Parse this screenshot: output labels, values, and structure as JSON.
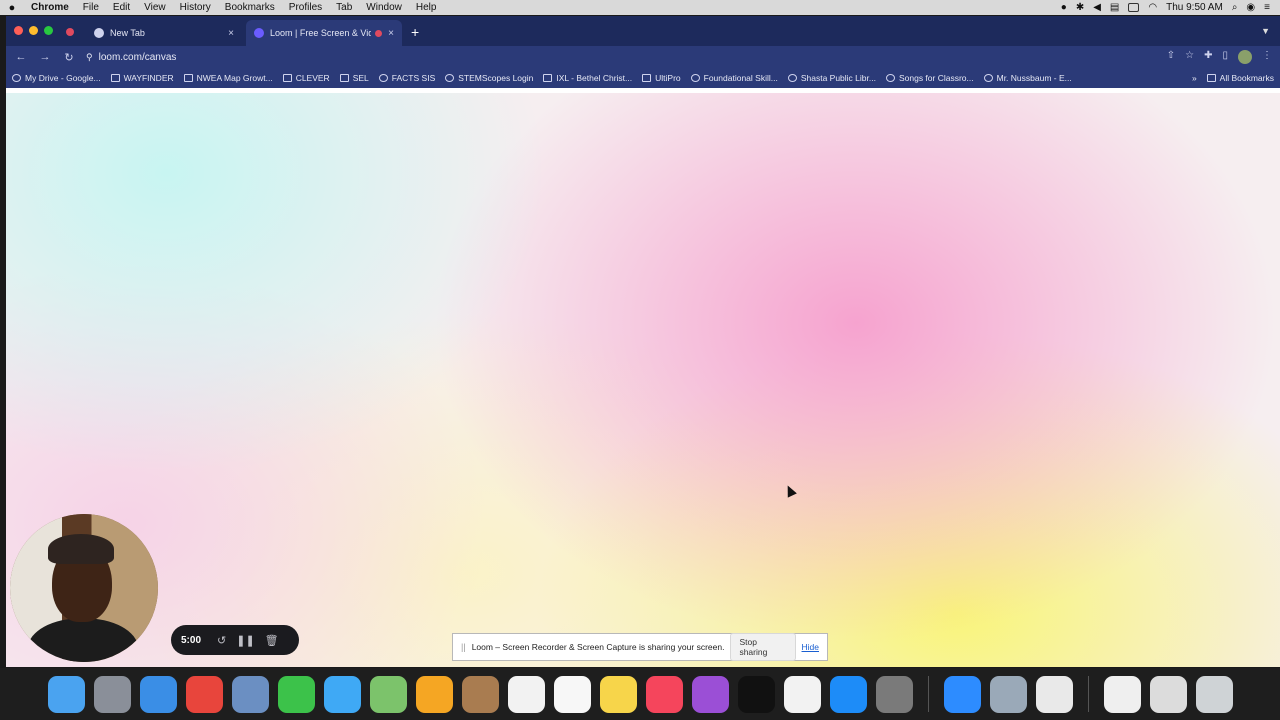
{
  "menubar": {
    "app_name": "Chrome",
    "items": [
      "File",
      "Edit",
      "View",
      "History",
      "Bookmarks",
      "Profiles",
      "Tab",
      "Window",
      "Help"
    ],
    "clock": "Thu 9:50 AM"
  },
  "browser": {
    "tabs": [
      {
        "title": "New Tab",
        "close": "×"
      },
      {
        "title": "Loom | Free Screen & Vide",
        "close": "×"
      }
    ],
    "new_tab": "+",
    "url": "loom.com/canvas",
    "bookmarks": [
      "My Drive - Google...",
      "WAYFINDER",
      "NWEA Map Growt...",
      "CLEVER",
      "SEL",
      "FACTS SIS",
      "STEMScopes Login",
      "IXL - Bethel Christ...",
      "UltiPro",
      "Foundational Skill...",
      "Shasta Public Libr...",
      "Songs for Classro...",
      "Mr. Nussbaum - E..."
    ],
    "bookmarks_overflow": "»",
    "all_bookmarks": "All Bookmarks"
  },
  "recorder": {
    "time": "5:00"
  },
  "sharing_bar": {
    "message": "Loom – Screen Recorder & Screen Capture is sharing your screen.",
    "stop_label": "Stop sharing",
    "hide_label": "Hide"
  },
  "dock": {
    "apps": [
      {
        "name": "finder-icon",
        "color": "#4aa3f0"
      },
      {
        "name": "launchpad-icon",
        "color": "#8a8f99"
      },
      {
        "name": "safari-icon",
        "color": "#3a8ee6"
      },
      {
        "name": "chrome-icon",
        "color": "#e8453c"
      },
      {
        "name": "preview-icon",
        "color": "#6b8fc2"
      },
      {
        "name": "facetime-icon",
        "color": "#3cc24a"
      },
      {
        "name": "messages-icon",
        "color": "#3fa9f5"
      },
      {
        "name": "maps-icon",
        "color": "#7cc36b"
      },
      {
        "name": "photos-icon",
        "color": "#f5a623"
      },
      {
        "name": "contacts-icon",
        "color": "#a97c50"
      },
      {
        "name": "calendar-icon",
        "color": "#f2f2f2"
      },
      {
        "name": "reminders-icon",
        "color": "#f7f7f7"
      },
      {
        "name": "notes-icon",
        "color": "#f7d54a"
      },
      {
        "name": "music-icon",
        "color": "#f5455c"
      },
      {
        "name": "podcasts-icon",
        "color": "#9b4fd6"
      },
      {
        "name": "apple-tv-icon",
        "color": "#111111"
      },
      {
        "name": "news-icon",
        "color": "#f2f2f2"
      },
      {
        "name": "app-store-icon",
        "color": "#1d8cf8"
      },
      {
        "name": "system-preferences-icon",
        "color": "#7a7a7a"
      },
      {
        "name": "zoom-icon",
        "color": "#2d8cff"
      },
      {
        "name": "image-capture-icon",
        "color": "#9aa9b8"
      },
      {
        "name": "textedit-icon",
        "color": "#e9e9e9"
      },
      {
        "name": "pdf-document-icon",
        "color": "#efefef"
      },
      {
        "name": "screenshot-document-icon",
        "color": "#dcdcdc"
      },
      {
        "name": "trash-icon",
        "color": "#cfd3d6"
      }
    ]
  }
}
